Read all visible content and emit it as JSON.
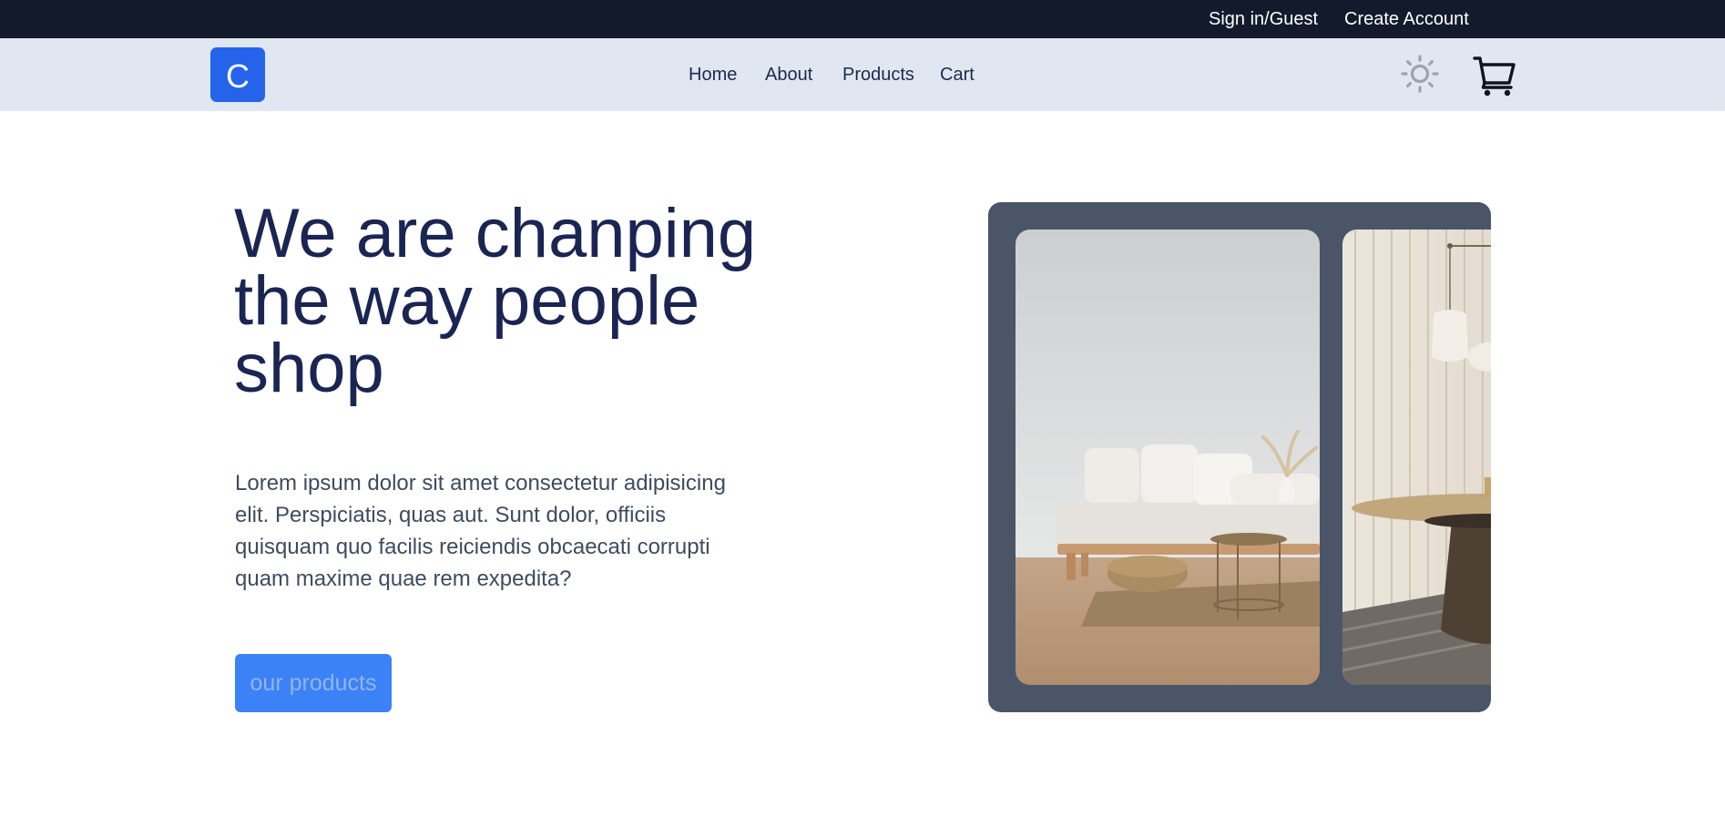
{
  "topbar": {
    "sign_in": "Sign in/Guest",
    "create_account": "Create Account"
  },
  "navbar": {
    "logo_letter": "C",
    "links": [
      "Home",
      "About",
      "Products",
      "Cart"
    ],
    "theme_icon": "sun-icon",
    "cart_icon": "cart-icon"
  },
  "hero": {
    "title": "We are chanping the way people shop",
    "text": "Lorem ipsum dolor sit amet consectetur adipisicing elit. Perspiciatis, quas aut. Sunt dolor, officiis quisquam quo facilis reiciendis obcaecati corrupti quam maxime quae rem expedita?",
    "cta": "our products"
  },
  "carousel": {
    "images": [
      "living-room-sofa-image",
      "dining-room-lamp-image"
    ]
  },
  "colors": {
    "topbar_bg": "#121a2c",
    "navbar_bg": "#e1e7f0",
    "primary": "#2563eb",
    "cta": "#3b82f6",
    "carousel_bg": "#4a5568",
    "title": "#1a2553"
  }
}
